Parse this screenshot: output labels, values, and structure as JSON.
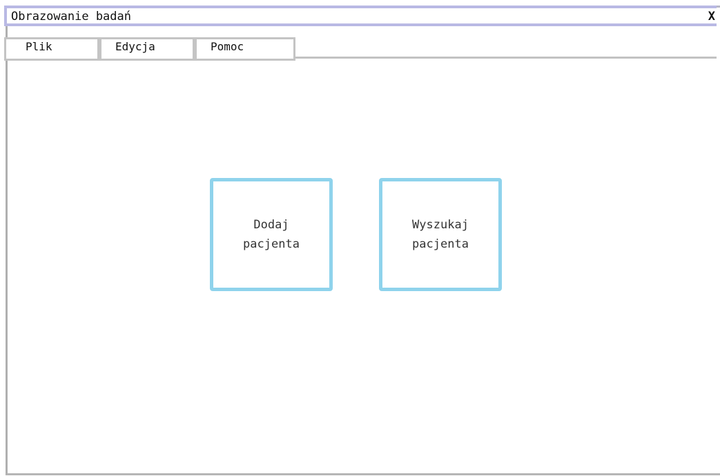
{
  "window": {
    "title": "Obrazowanie badań",
    "close_label": "X"
  },
  "menu": {
    "items": [
      {
        "label": "Plik"
      },
      {
        "label": "Edycja"
      },
      {
        "label": "Pomoc"
      }
    ]
  },
  "main": {
    "actions": [
      {
        "label": "Dodaj\npacjenta",
        "icon": "none"
      },
      {
        "label": "Wyszukaj\npacjenta",
        "icon": "none"
      }
    ]
  },
  "colors": {
    "titlebar_border": "#b9b9e4",
    "card_border": "#8fd3ec",
    "menu_border": "#c4c4c4"
  }
}
